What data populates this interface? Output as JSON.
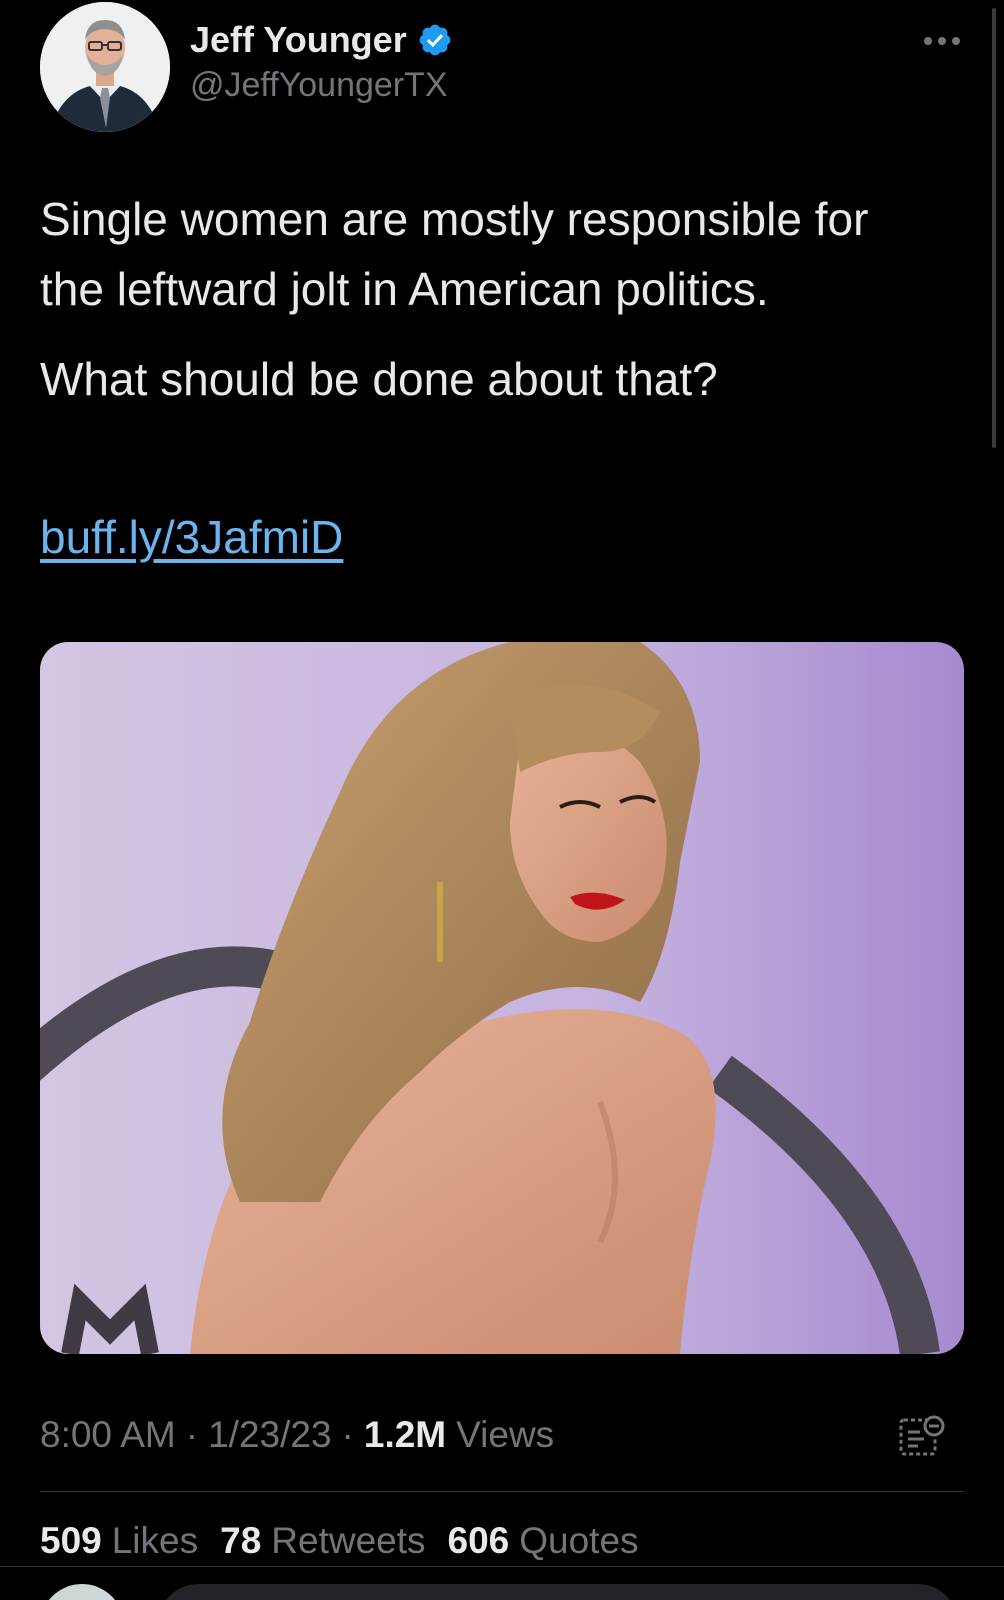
{
  "author": {
    "display_name": "Jeff Younger",
    "handle": "@JeffYoungerTX",
    "verified": true,
    "avatar_icon": "profile-photo"
  },
  "tweet": {
    "paragraphs": [
      "Single women are mostly responsible for the leftward jolt in American politics.",
      "What should be done about that?"
    ],
    "link": "buff.ly/3JafmiD",
    "media_icon": "photo-woman-looking-over-shoulder"
  },
  "meta": {
    "time": "8:00 AM",
    "date": "1/23/23",
    "separator": "·",
    "views_count": "1.2M",
    "views_label": "Views"
  },
  "stats": {
    "likes_count": "509",
    "likes_label": "Likes",
    "retweets_count": "78",
    "retweets_label": "Retweets",
    "quotes_count": "606",
    "quotes_label": "Quotes"
  },
  "colors": {
    "background": "#000000",
    "text": "#e7e9ea",
    "secondary": "#71767b",
    "link": "#6cb4ee",
    "verified": "#1d9bf0"
  }
}
